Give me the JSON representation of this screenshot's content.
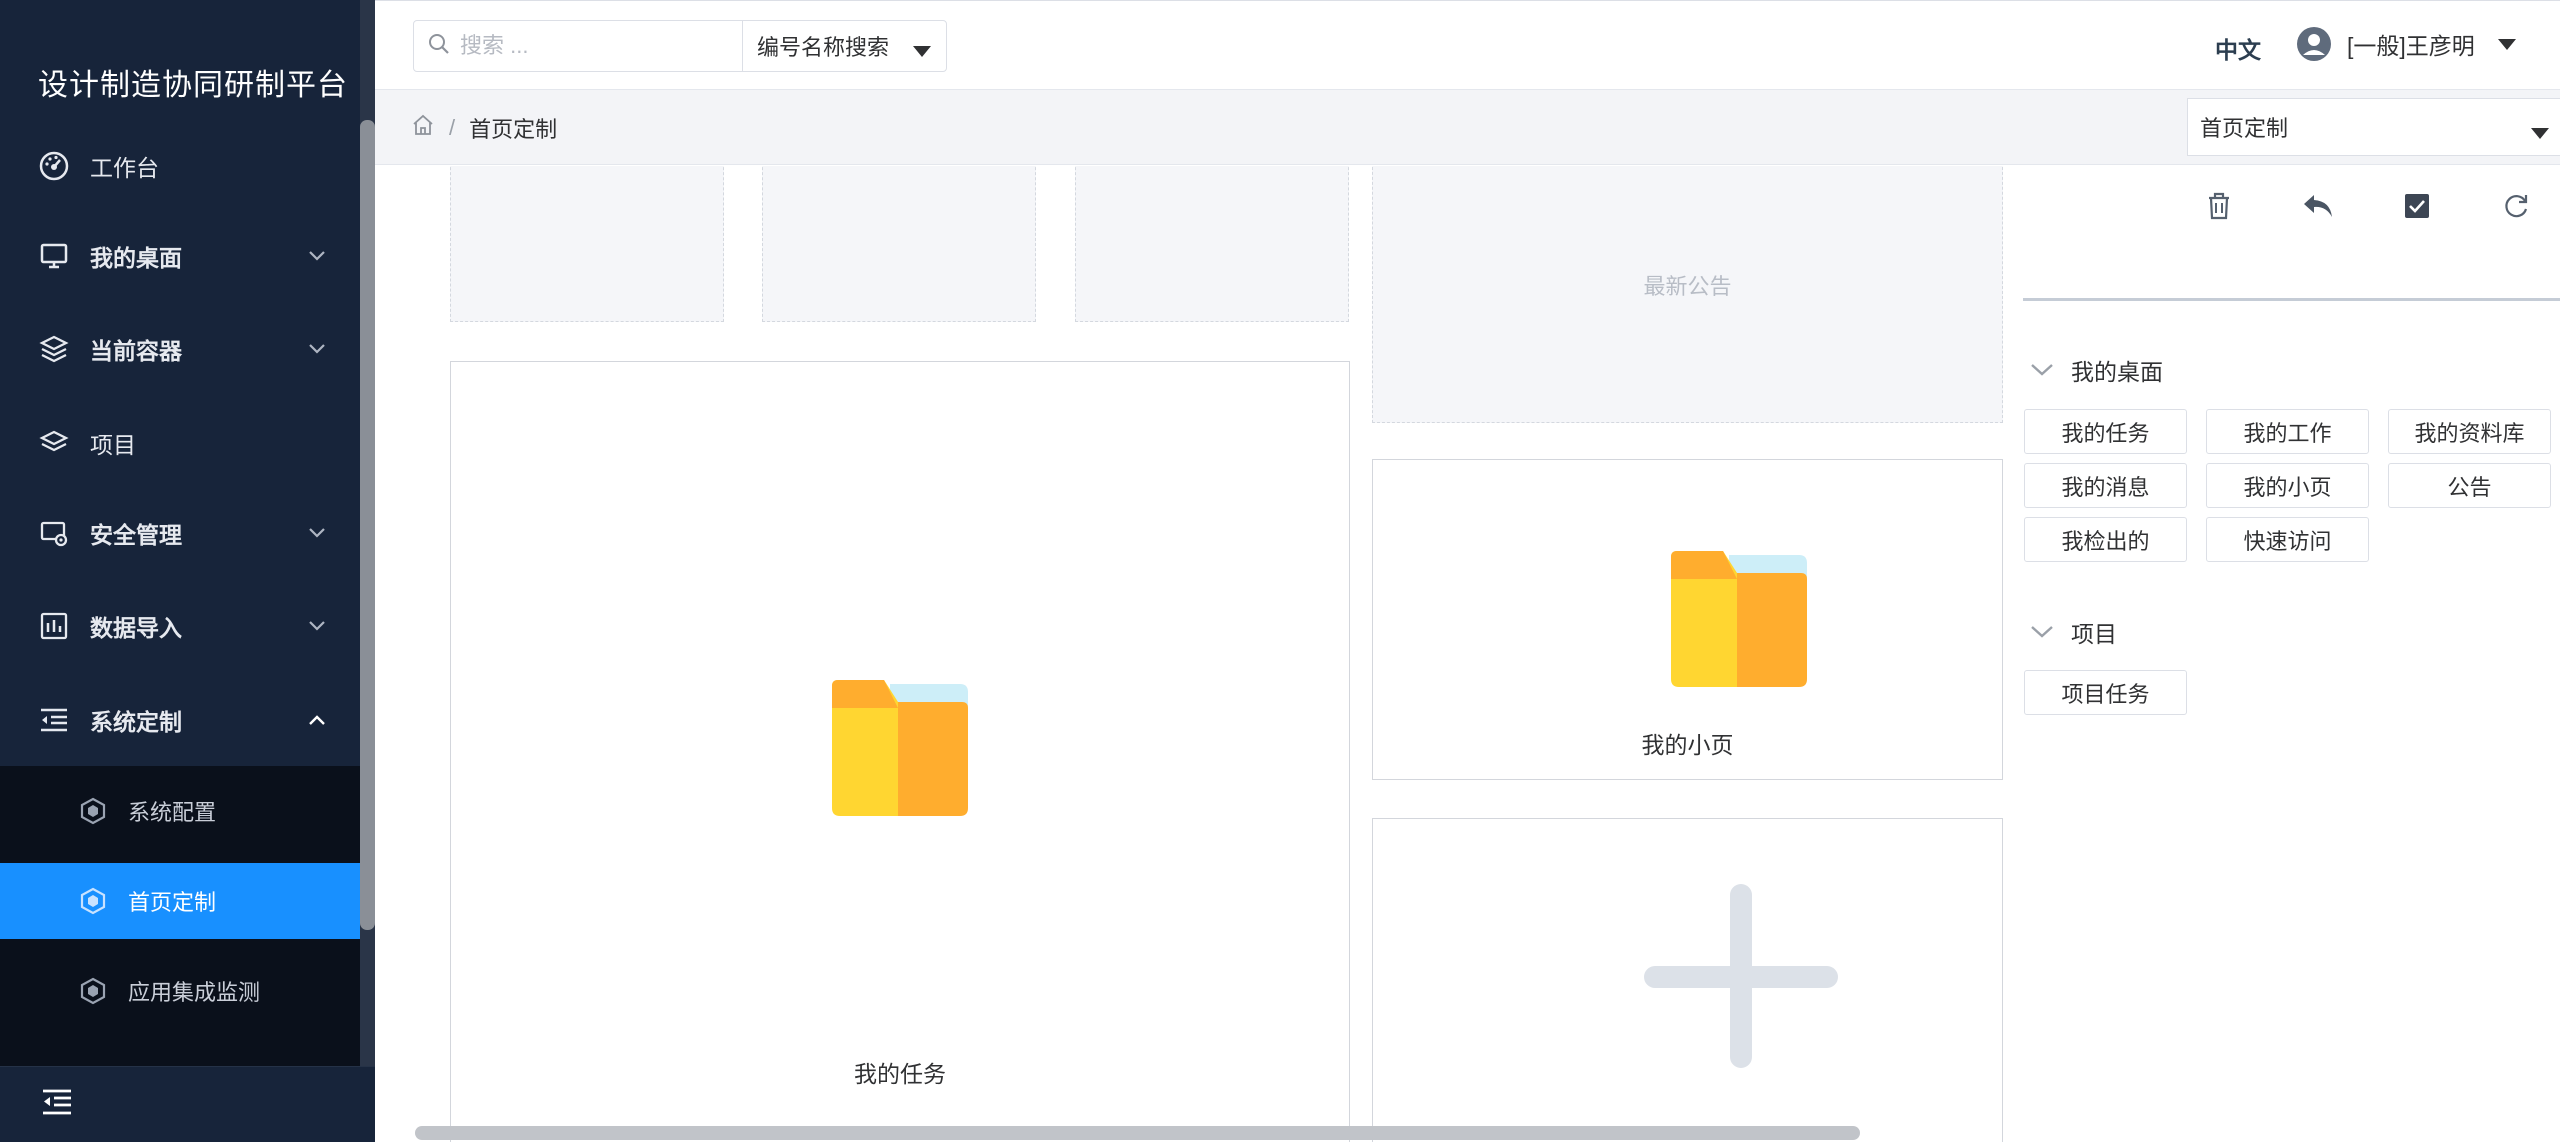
{
  "sidebar": {
    "brand": "设计制造协同研制平台",
    "items": [
      {
        "label": "工作台",
        "icon": "dashboard-icon"
      },
      {
        "label": "我的桌面",
        "icon": "monitor-icon"
      },
      {
        "label": "当前容器",
        "icon": "layers-icon"
      },
      {
        "label": "项目",
        "icon": "layers-outline-icon"
      },
      {
        "label": "安全管理",
        "icon": "security-settings-icon"
      },
      {
        "label": "数据导入",
        "icon": "data-import-icon"
      },
      {
        "label": "系统定制",
        "icon": "indent-list-icon"
      }
    ],
    "subitems": [
      {
        "label": "系统配置",
        "icon": "cube-icon"
      },
      {
        "label": "首页定制",
        "icon": "cube-icon"
      },
      {
        "label": "应用集成监测",
        "icon": "cube-icon"
      }
    ],
    "active_subitem": "首页定制"
  },
  "header": {
    "search_placeholder": "搜索 ...",
    "search_mode": "编号名称搜索",
    "language": "中文",
    "user": "[一般]王彦明"
  },
  "breadcrumb": {
    "current": "首页定制",
    "page_select": "首页定制"
  },
  "canvas": {
    "notice_label": "最新公告",
    "card_tasks_title": "我的任务",
    "card_page_title": "我的小页"
  },
  "panel": {
    "groups": [
      {
        "title": "我的桌面",
        "chips": [
          "我的任务",
          "我的工作",
          "我的资料库",
          "我的消息",
          "我的小页",
          "公告",
          "我检出的",
          "快速访问"
        ]
      },
      {
        "title": "项目",
        "chips": [
          "项目任务"
        ]
      }
    ]
  },
  "colors": {
    "sidebar_bg": "#17243a",
    "submenu_bg": "#0a101b",
    "active": "#1890ff",
    "folder_front": "#ffd631",
    "folder_back": "#ffad2e",
    "folder_paper": "#cdeef8"
  }
}
